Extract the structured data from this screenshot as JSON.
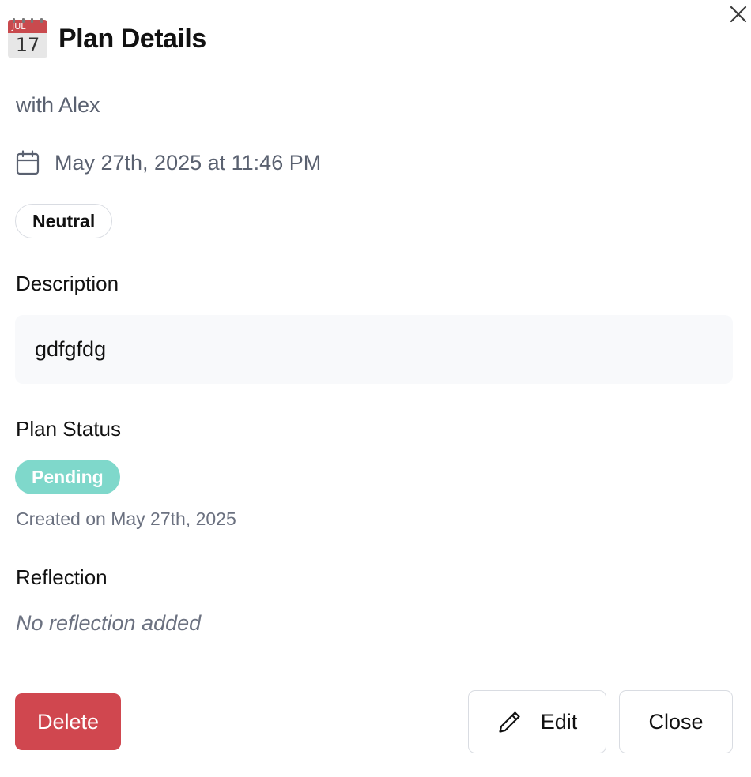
{
  "header": {
    "icon": "calendar-emoji-icon",
    "icon_month": "JUL",
    "icon_day": "17",
    "title": "Plan Details",
    "close_icon": "close-icon"
  },
  "partner_text": "with Alex",
  "datetime": {
    "icon": "calendar-icon",
    "text": "May 27th, 2025 at 11:46 PM"
  },
  "mood_badge": "Neutral",
  "description": {
    "label": "Description",
    "value": "gdfgfdg"
  },
  "status": {
    "label": "Plan Status",
    "value": "Pending",
    "color": "#7fd8cb",
    "created_text": "Created on May 27th, 2025"
  },
  "reflection": {
    "label": "Reflection",
    "value": "No reflection added"
  },
  "actions": {
    "delete_label": "Delete",
    "delete_color": "#d0474f",
    "edit_label": "Edit",
    "edit_icon": "pencil-icon",
    "close_label": "Close"
  }
}
